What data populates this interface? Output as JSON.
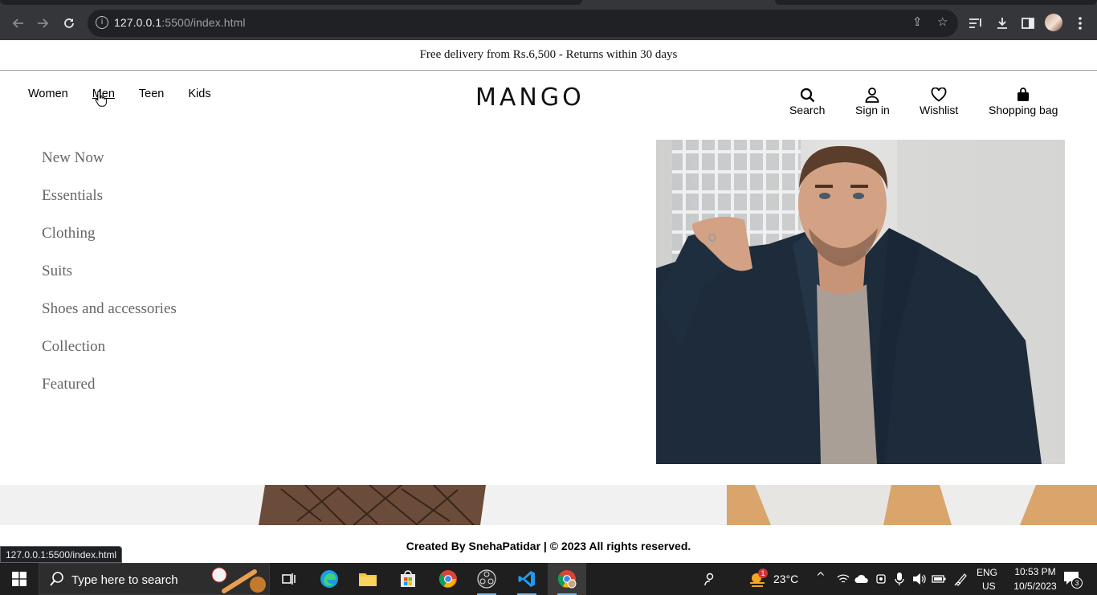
{
  "browser": {
    "url_host": "127.0.0.1",
    "url_rest": ":5500/index.html",
    "status_url": "127.0.0.1:5500/index.html"
  },
  "promo": {
    "text": "Free delivery from Rs.6,500 - Returns within 30 days"
  },
  "nav": {
    "categories": [
      "Women",
      "Men",
      "Teen",
      "Kids"
    ],
    "active": "Men",
    "logo": "MANGO",
    "actions": {
      "search": "Search",
      "signin": "Sign in",
      "wishlist": "Wishlist",
      "bag": "Shopping bag"
    }
  },
  "menu": {
    "items": [
      "New Now",
      "Essentials",
      "Clothing",
      "Suits",
      "Shoes and accessories",
      "Collection",
      "Featured"
    ]
  },
  "footer": {
    "credit": "Created By  SnehaPatidar | © 2023 All rights reserved."
  },
  "taskbar": {
    "search_placeholder": "Type here to search",
    "weather": "23°C",
    "weather_badge": "1",
    "lang_top": "ENG",
    "lang_bottom": "US",
    "time": "10:53 PM",
    "date": "10/5/2023",
    "notif_count": "3"
  },
  "colors": {
    "chrome_dark": "#35363a",
    "omnibox": "#202124",
    "menu_text": "#666666",
    "taskbar": "#1f1f1f"
  }
}
